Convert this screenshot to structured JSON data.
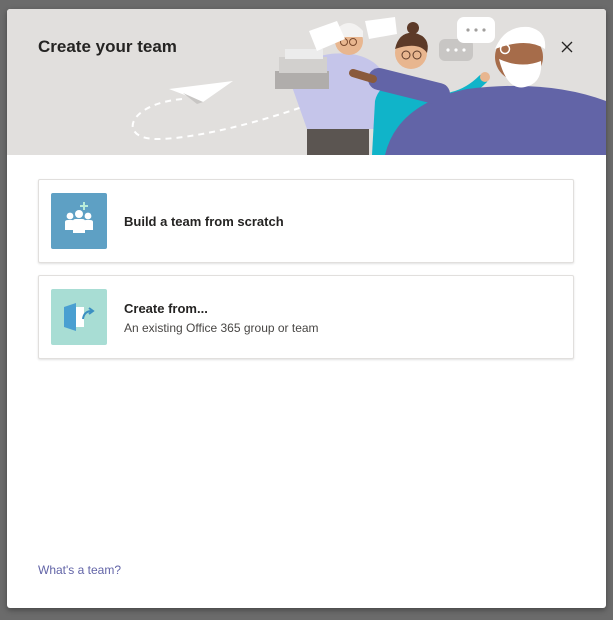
{
  "dialog": {
    "title": "Create your team",
    "close_icon": "close-icon"
  },
  "options": [
    {
      "title": "Build a team from scratch",
      "subtitle": "",
      "icon": "team-add-icon",
      "icon_bg": "#5ea0c4"
    },
    {
      "title": "Create from...",
      "subtitle": "An existing Office 365 group or team",
      "icon": "group-import-icon",
      "icon_bg": "#a8ddd4"
    }
  ],
  "footer": {
    "help_link": "What's a team?"
  },
  "colors": {
    "accent": "#6264a7",
    "header_bg": "#e1dfdd"
  }
}
